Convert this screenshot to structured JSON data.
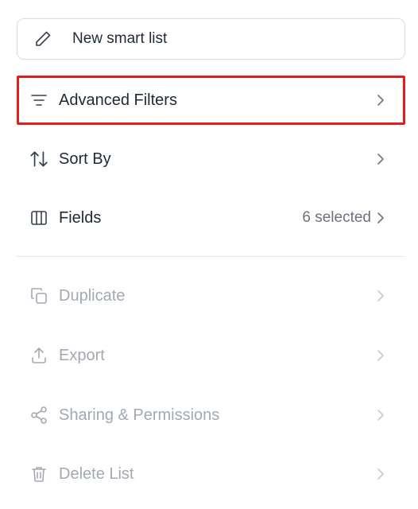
{
  "new_list": {
    "label": "New smart list",
    "icon": "pencil-icon"
  },
  "menu": {
    "advanced_filters": {
      "label": "Advanced Filters",
      "icon": "filter-lines-icon"
    },
    "sort_by": {
      "label": "Sort By",
      "icon": "sort-arrows-icon"
    },
    "fields": {
      "label": "Fields",
      "meta": "6 selected",
      "icon": "columns-icon"
    },
    "duplicate": {
      "label": "Duplicate",
      "icon": "copy-icon"
    },
    "export": {
      "label": "Export",
      "icon": "upload-icon"
    },
    "sharing": {
      "label": "Sharing & Permissions",
      "icon": "share-icon"
    },
    "delete": {
      "label": "Delete List",
      "icon": "trash-icon"
    }
  },
  "colors": {
    "highlight": "#e11d1d",
    "active_text": "#1f2937",
    "disabled_text": "#a3a9b3"
  }
}
